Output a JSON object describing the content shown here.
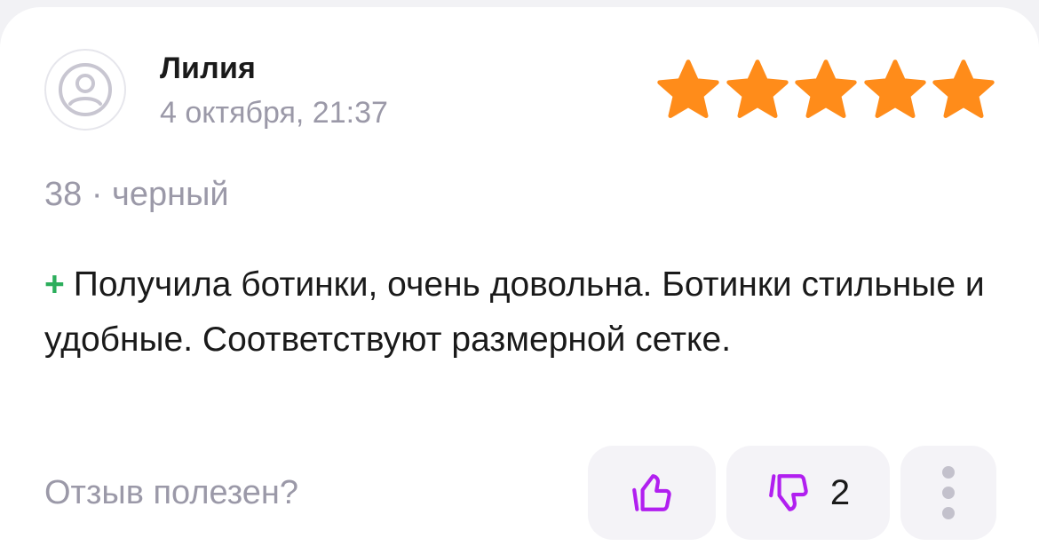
{
  "review": {
    "author_name": "Лилия",
    "date": "4 октября, 21:37",
    "rating": 5,
    "rating_max": 5,
    "variant": "38 · черный",
    "text_marker": "+",
    "text": "Получила ботинки, очень довольна. Ботинки стильные и удобные. Соответствуют размерной сетке."
  },
  "feedback": {
    "helpful_label": "Отзыв полезен?",
    "dislike_count": "2"
  },
  "icons": {
    "avatar": "sad-face-avatar-icon",
    "star": "star-icon",
    "like": "thumbs-up-icon",
    "dislike": "thumbs-down-icon",
    "more": "more-vertical-icon"
  },
  "colors": {
    "star": "#ff8c1a",
    "vote_icon": "#b11ff0",
    "plus_marker": "#2cae5c",
    "secondary_text": "#9b99a8"
  }
}
